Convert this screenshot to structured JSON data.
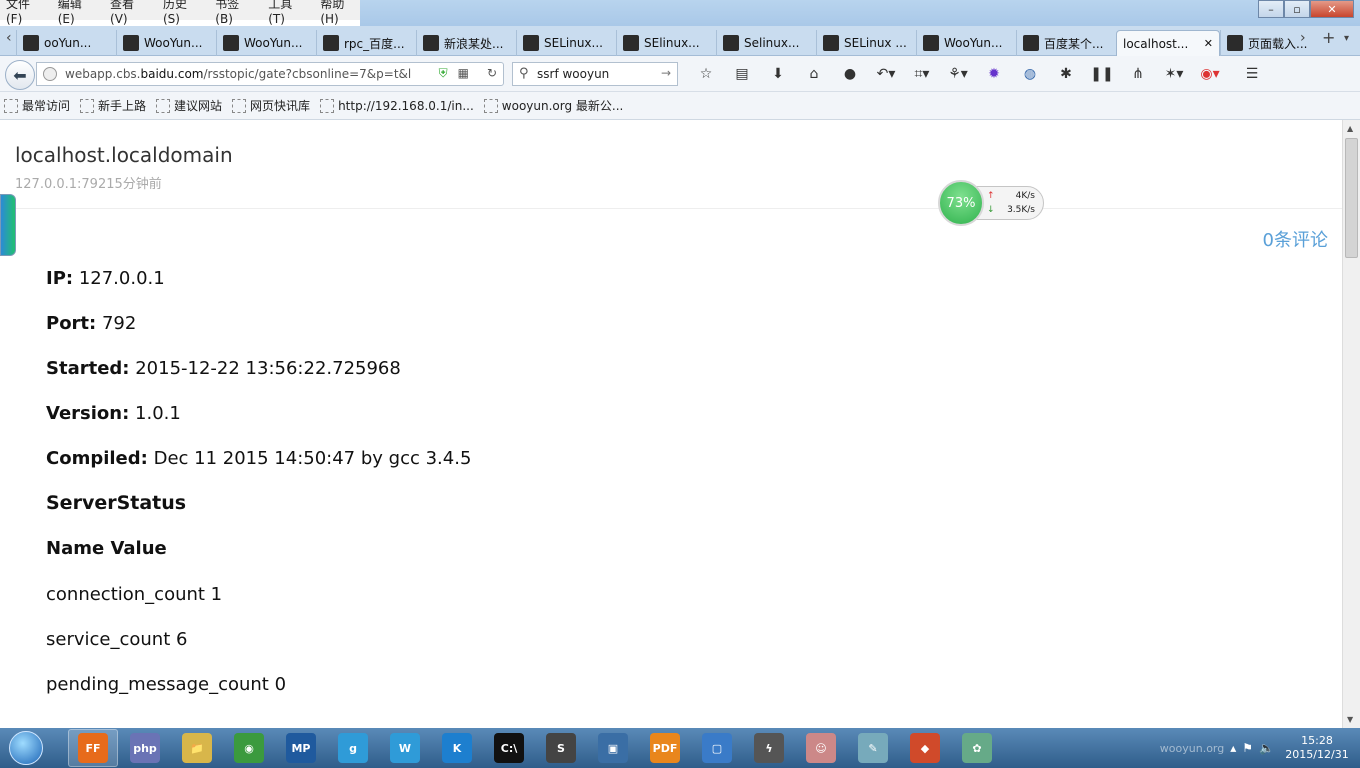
{
  "menu": [
    "文件(F)",
    "编辑(E)",
    "查看(V)",
    "历史(S)",
    "书签(B)",
    "工具(T)",
    "帮助(H)"
  ],
  "window_controls": {
    "min": "–",
    "max": "▫",
    "close": "✕"
  },
  "tabs": [
    {
      "label": "ooYun...",
      "icon": "wooyun-icon"
    },
    {
      "label": "WooYun...",
      "icon": "wooyun-icon"
    },
    {
      "label": "WooYun...",
      "icon": "wooyun-icon"
    },
    {
      "label": "rpc_百度...",
      "icon": "baidu-icon"
    },
    {
      "label": "新浪某处...",
      "icon": "wooyun-icon"
    },
    {
      "label": "SELinux...",
      "icon": "csdn-icon"
    },
    {
      "label": "SElinux...",
      "icon": "redhat-icon"
    },
    {
      "label": "Selinux...",
      "icon": "shield-icon"
    },
    {
      "label": "SELinux ...",
      "icon": "google-icon"
    },
    {
      "label": "WooYun...",
      "icon": "wooyun-icon"
    },
    {
      "label": "百度某个...",
      "icon": "wooyun-icon"
    },
    {
      "label": "localhost...",
      "icon": "",
      "active": true
    },
    {
      "label": "页面载入...",
      "icon": "warning-icon"
    }
  ],
  "tab_close": "✕",
  "new_tab": "+",
  "nav": {
    "url_prefix": "webapp.cbs.",
    "url_domain": "baidu.com",
    "url_rest": "/rsstopic/gate?cbsonline=7&p=t&l",
    "search_value": "ssrf wooyun"
  },
  "bookmarks": [
    "最常访问",
    "新手上路",
    "建议网站",
    "网页快讯库",
    "http://192.168.0.1/in...",
    "wooyun.org 最新公..."
  ],
  "page": {
    "host": "localhost.localdomain",
    "meta": "127.0.0.1:79215分钟前",
    "comments": "0条评论",
    "fields": [
      {
        "label": "IP:",
        "value": " 127.0.0.1"
      },
      {
        "label": "Port:",
        "value": " 792"
      },
      {
        "label": "Started:",
        "value": " 2015-12-22 13:56:22.725968"
      },
      {
        "label": "Version:",
        "value": " 1.0.1"
      },
      {
        "label": "Compiled:",
        "value": " Dec 11 2015 14:50:47 by gcc 3.4.5"
      }
    ],
    "section_title": "ServerStatus",
    "table_header": "Name Value",
    "rows": [
      "connection_count 1",
      "service_count 6",
      "pending_message_count 0"
    ]
  },
  "net_widget": {
    "percent": "73%",
    "up": "4K/s",
    "down": "3.5K/s",
    "percent_value": 73
  },
  "taskbar": {
    "apps": [
      {
        "name": "firefox",
        "label": "FF",
        "color": "#e76b1b",
        "active": true
      },
      {
        "name": "php",
        "label": "php",
        "color": "#6a73b5"
      },
      {
        "name": "explorer",
        "label": "📁",
        "color": "#d8b64a"
      },
      {
        "name": "chrome",
        "label": "◉",
        "color": "#3b9a3e"
      },
      {
        "name": "mp",
        "label": "MP",
        "color": "#1f5a9e"
      },
      {
        "name": "app-g",
        "label": "g",
        "color": "#2f9bd8"
      },
      {
        "name": "app-w",
        "label": "W",
        "color": "#2f9bd8"
      },
      {
        "name": "app-k",
        "label": "K",
        "color": "#1d7fcf"
      },
      {
        "name": "cmd",
        "label": "C:\\",
        "color": "#111"
      },
      {
        "name": "sublime",
        "label": "S",
        "color": "#444"
      },
      {
        "name": "remote",
        "label": "▣",
        "color": "#3a6ea5"
      },
      {
        "name": "pdf",
        "label": "PDF",
        "color": "#e9861c"
      },
      {
        "name": "vm",
        "label": "▢",
        "color": "#3a7bc8"
      },
      {
        "name": "burp",
        "label": "ϟ",
        "color": "#555"
      },
      {
        "name": "photo",
        "label": "☺",
        "color": "#c88"
      },
      {
        "name": "notes",
        "label": "✎",
        "color": "#7ab"
      },
      {
        "name": "git",
        "label": "◆",
        "color": "#d04a2a"
      },
      {
        "name": "paint",
        "label": "✿",
        "color": "#6a8"
      }
    ],
    "time": "15:28",
    "date": "2015/12/31",
    "tray_text": "wooyun.org"
  }
}
